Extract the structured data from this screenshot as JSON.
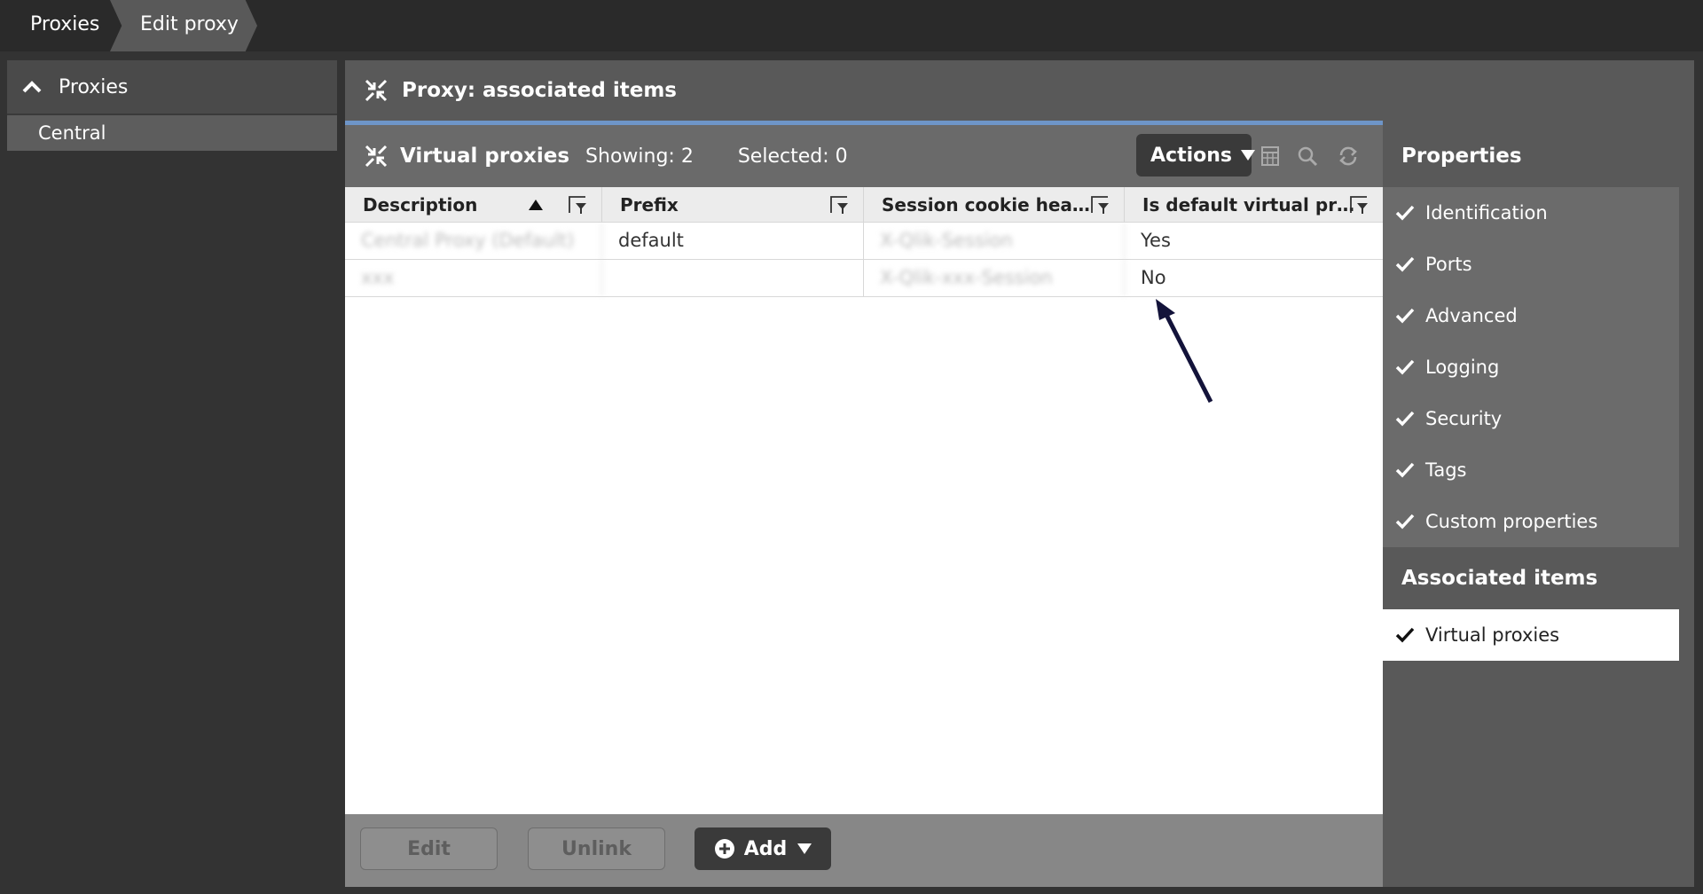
{
  "breadcrumb": {
    "items": [
      "Proxies",
      "Edit proxy"
    ]
  },
  "left_panel": {
    "header": "Proxies",
    "items": [
      "Central"
    ]
  },
  "main": {
    "title": "Proxy: associated items"
  },
  "grid": {
    "title": "Virtual proxies",
    "showing": "Showing:  2",
    "selected": "Selected: 0",
    "actions_label": "Actions",
    "columns": [
      "Description",
      "Prefix",
      "Session cookie hea…",
      "Is default virtual pr…"
    ],
    "rows": [
      [
        "Central Proxy (Default)",
        "default",
        "X-Qlik-Session",
        "Yes"
      ],
      [
        "xxx",
        "",
        "X-Qlik-xxx-Session",
        "No"
      ]
    ]
  },
  "buttons": {
    "edit": "Edit",
    "unlink": "Unlink",
    "add": "Add"
  },
  "properties": {
    "header": "Properties",
    "items": [
      "Identification",
      "Ports",
      "Advanced",
      "Logging",
      "Security",
      "Tags",
      "Custom properties"
    ]
  },
  "associated": {
    "header": "Associated items",
    "items": [
      "Virtual proxies"
    ]
  },
  "icons": {
    "collapse": "chevron-up-icon",
    "proxy": "proxy-compress-icon",
    "filter": "column-filter-icon",
    "check": "check-icon",
    "columns": "table-columns-icon",
    "search": "search-icon",
    "refresh": "refresh-icon",
    "add": "plus-circle-icon"
  },
  "colors": {
    "accent_line": "#6e95c8",
    "background": "#333333",
    "panel": "#595959"
  }
}
